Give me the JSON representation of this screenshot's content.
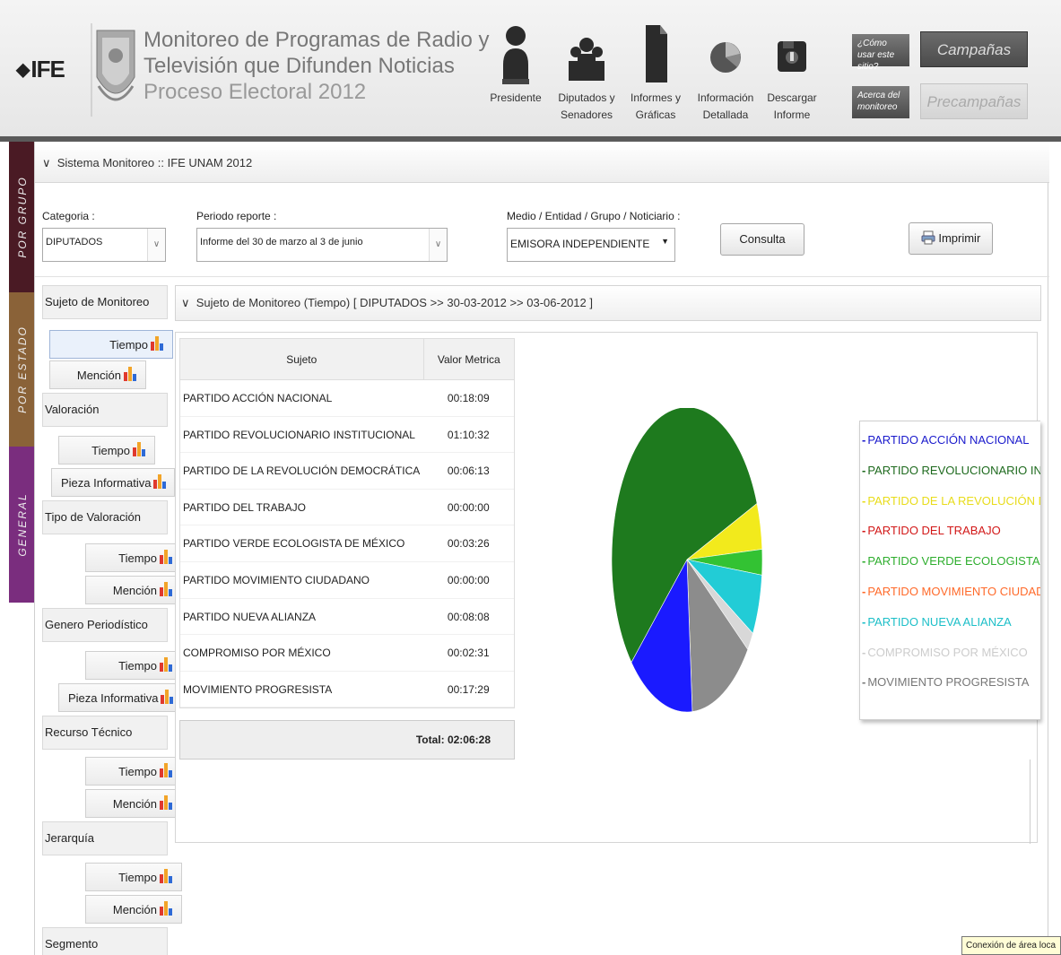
{
  "header": {
    "logo_text": "IFE",
    "title_line1": "Monitoreo de Programas de Radio y",
    "title_line2": "Televisión que Difunden Noticias",
    "title_line3": "Proceso Electoral 2012",
    "nav": [
      {
        "label": "Presidente",
        "icon": "person-icon"
      },
      {
        "label": "Diputados y Senadores",
        "icon": "group-icon"
      },
      {
        "label": "Informes y Gráficas",
        "icon": "document-icon"
      },
      {
        "label": "Información Detallada",
        "icon": "pie-chart-icon"
      },
      {
        "label": "Descargar Informe",
        "icon": "download-icon"
      }
    ],
    "help_link": "¿Cómo usar este sitio?",
    "about_link": "Acerca del monitoreo",
    "campaigns_button": "Campañas",
    "precampaigns_button": "Precampañas"
  },
  "side_tabs": [
    "POR GRUPO",
    "POR ESTADO",
    "GENERAL"
  ],
  "system_bar": "Sistema Monitoreo :: IFE UNAM 2012",
  "filters": {
    "category_label": "Categoria :",
    "category_value": "DIPUTADOS",
    "period_label": "Periodo reporte :",
    "period_value": "Informe del 30 de marzo al 3 de junio",
    "media_label": "Medio / Entidad / Grupo / Noticiario :",
    "media_value": "EMISORA INDEPENDIENTE",
    "consult_button": "Consulta",
    "print_button": "Imprimir"
  },
  "sidebar": [
    {
      "header": "Sujeto de Monitoreo",
      "buttons": [
        "Tiempo",
        "Mención"
      ]
    },
    {
      "header": "Valoración",
      "buttons": [
        "Tiempo",
        "Pieza Informativa"
      ]
    },
    {
      "header": "Tipo de Valoración",
      "buttons": [
        "Tiempo",
        "Mención"
      ]
    },
    {
      "header": "Genero Periodístico",
      "buttons": [
        "Tiempo",
        "Pieza Informativa"
      ]
    },
    {
      "header": "Recurso Técnico",
      "buttons": [
        "Tiempo",
        "Mención"
      ]
    },
    {
      "header": "Jerarquía",
      "buttons": [
        "Tiempo",
        "Mención"
      ]
    },
    {
      "header": "Segmento",
      "buttons": []
    }
  ],
  "content_header": "Sujeto de Monitoreo (Tiempo) [ DIPUTADOS >> 30-03-2012 >> 03-06-2012 ]",
  "table": {
    "columns": [
      "Sujeto",
      "Valor Metrica"
    ],
    "rows": [
      [
        "PARTIDO ACCIÓN NACIONAL",
        "00:18:09"
      ],
      [
        "PARTIDO REVOLUCIONARIO INSTITUCIONAL",
        "01:10:32"
      ],
      [
        "PARTIDO DE LA REVOLUCIÓN DEMOCRÁTICA",
        "00:06:13"
      ],
      [
        "PARTIDO DEL TRABAJO",
        "00:00:00"
      ],
      [
        "PARTIDO VERDE ECOLOGISTA DE MÉXICO",
        "00:03:26"
      ],
      [
        "PARTIDO MOVIMIENTO CIUDADANO",
        "00:00:00"
      ],
      [
        "PARTIDO NUEVA ALIANZA",
        "00:08:08"
      ],
      [
        "COMPROMISO POR MÉXICO",
        "00:02:31"
      ],
      [
        "MOVIMIENTO PROGRESISTA",
        "00:17:29"
      ]
    ],
    "total": "Total: 02:06:28"
  },
  "chart_data": {
    "type": "pie",
    "title": "",
    "categories": [
      "PARTIDO ACCIÓN NACIONAL",
      "PARTIDO REVOLUCIONARIO INSTITUCIONAL",
      "PARTIDO DE LA REVOLUCIÓN DEMOCRÁTICA",
      "PARTIDO DEL TRABAJO",
      "PARTIDO VERDE ECOLOGISTA DE MÉXICO",
      "PARTIDO MOVIMIENTO CIUDADANO",
      "PARTIDO NUEVA ALIANZA",
      "COMPROMISO POR MÉXICO",
      "MOVIMIENTO PROGRESISTA"
    ],
    "legend_labels": [
      "PARTIDO ACCIÓN NACIONAL",
      "PARTIDO REVOLUCIONARIO INS",
      "PARTIDO DE LA REVOLUCIÓN DE",
      "PARTIDO DEL TRABAJO",
      "PARTIDO VERDE ECOLOGISTA D",
      "PARTIDO MOVIMIENTO CIUDADA",
      "PARTIDO NUEVA ALIANZA",
      "COMPROMISO POR MÉXICO",
      "MOVIMIENTO PROGRESISTA"
    ],
    "values_seconds": [
      1089,
      4232,
      373,
      0,
      206,
      0,
      488,
      151,
      1049
    ],
    "colors": [
      "#1a1aff",
      "#1e7a1e",
      "#f2ea1c",
      "#e01b1b",
      "#33c233",
      "#ff6a2a",
      "#22ccd6",
      "#d8d8d8",
      "#8c8c8c"
    ],
    "legend_text_colors": [
      "#1a1acc",
      "#1e6a1e",
      "#e8dc1a",
      "#d21818",
      "#2eae2e",
      "#ff6a2a",
      "#1cbfc8",
      "#cccccc",
      "#777777"
    ],
    "legend_position": "right"
  },
  "status_bar": "Conexión de área loca"
}
